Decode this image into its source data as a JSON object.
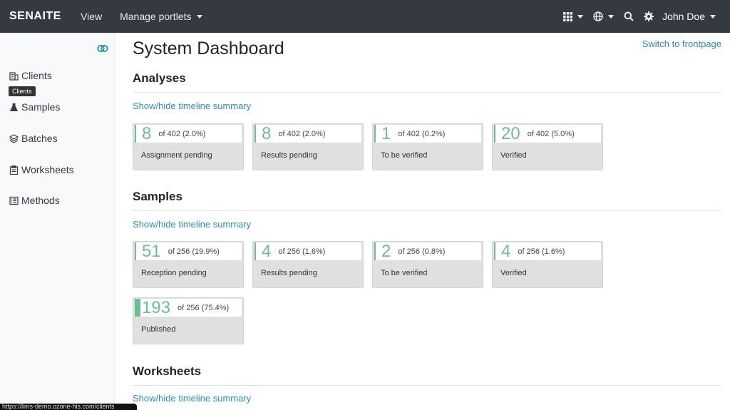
{
  "navbar": {
    "brand": "SENAITE",
    "view": "View",
    "manage_portlets": "Manage portlets",
    "user": "John Doe"
  },
  "sidebar": {
    "tooltip": "Clients",
    "items": [
      {
        "label": "Clients"
      },
      {
        "label": "Samples"
      },
      {
        "label": "Batches"
      },
      {
        "label": "Worksheets"
      },
      {
        "label": "Methods"
      }
    ]
  },
  "main": {
    "title": "System Dashboard",
    "switch_link": "Switch to frontpage",
    "sections": [
      {
        "title": "Analyses",
        "toggle": "Show/hide timeline summary",
        "cards": [
          {
            "number": "8",
            "of": "of 402 (2.0%)",
            "label": "Assignment pending",
            "fraction": 0.02
          },
          {
            "number": "8",
            "of": "of 402 (2.0%)",
            "label": "Results pending",
            "fraction": 0.02
          },
          {
            "number": "1",
            "of": "of 402 (0.2%)",
            "label": "To be verified",
            "fraction": 0.002
          },
          {
            "number": "20",
            "of": "of 402 (5.0%)",
            "label": "Verified",
            "fraction": 0.05
          }
        ]
      },
      {
        "title": "Samples",
        "toggle": "Show/hide timeline summary",
        "cards": [
          {
            "number": "51",
            "of": "of 256 (19.9%)",
            "label": "Reception pending",
            "fraction": 0.199
          },
          {
            "number": "4",
            "of": "of 256 (1.6%)",
            "label": "Results pending",
            "fraction": 0.016
          },
          {
            "number": "2",
            "of": "of 256 (0.8%)",
            "label": "To be verified",
            "fraction": 0.008
          },
          {
            "number": "4",
            "of": "of 256 (1.6%)",
            "label": "Verified",
            "fraction": 0.016
          },
          {
            "number": "193",
            "of": "of 256 (75.4%)",
            "label": "Published",
            "fraction": 0.754
          }
        ]
      },
      {
        "title": "Worksheets",
        "toggle": "Show/hide timeline summary"
      }
    ]
  },
  "statusbar": {
    "url": "https://lims-demo.ozone-his.com/clients"
  },
  "colors": {
    "accent": "#6fbf8e",
    "link": "#2a8ab8",
    "navbar": "#343a40"
  }
}
